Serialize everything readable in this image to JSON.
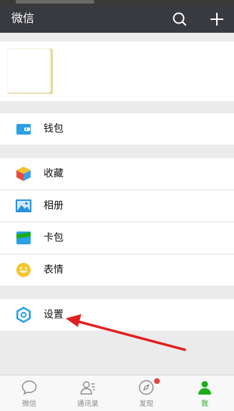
{
  "header": {
    "title": "微信"
  },
  "menu": {
    "wallet": "钱包",
    "favorites": "收藏",
    "album": "相册",
    "cards": "卡包",
    "stickers": "表情",
    "settings": "设置"
  },
  "tabs": [
    {
      "label": "微信",
      "active": false
    },
    {
      "label": "通讯录",
      "active": false
    },
    {
      "label": "发现",
      "active": false
    },
    {
      "label": "我",
      "active": true
    }
  ],
  "colors": {
    "header": "#393a3f",
    "accent": "#1aad19",
    "background": "#ebebeb",
    "annotation_arrow": "#e02020"
  }
}
